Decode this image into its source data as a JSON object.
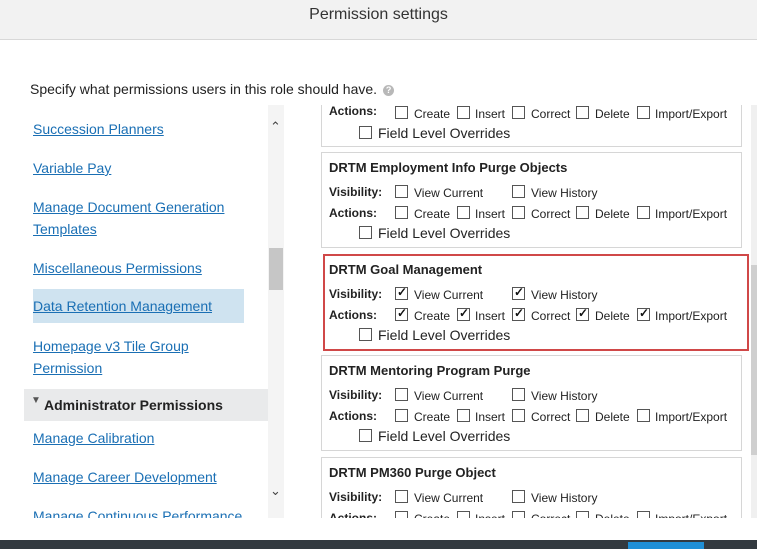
{
  "dialog": {
    "title": "Permission settings"
  },
  "description": {
    "text": "Specify what permissions users in this role should have.",
    "help_icon": "?"
  },
  "left_nav": {
    "items": [
      {
        "label": "Succession Planners"
      },
      {
        "label": "Variable Pay"
      },
      {
        "label": "Manage Document Generation Templates"
      },
      {
        "label": "Miscellaneous Permissions"
      },
      {
        "label": "Data Retention Management",
        "selected": true
      },
      {
        "label": "Homepage v3 Tile Group Permission"
      }
    ],
    "section": {
      "label": "Administrator Permissions",
      "icon": "triangle-down-icon"
    },
    "section_items": [
      {
        "label": "Manage Calibration"
      },
      {
        "label": "Manage Career Development"
      },
      {
        "label": "Manage Continuous Performance"
      }
    ],
    "scroll_up": "⌃",
    "scroll_down": "⌄"
  },
  "labels": {
    "visibility": "Visibility:",
    "actions": "Actions:",
    "view_current": "View Current",
    "view_history": "View History",
    "create": "Create",
    "insert": "Insert",
    "correct": "Correct",
    "delete": "Delete",
    "import_export": "Import/Export",
    "field_overrides": "Field Level Overrides"
  },
  "cards": [
    {
      "title": "",
      "visibility": null,
      "actions": {
        "create": false,
        "insert": false,
        "correct": false,
        "delete": false,
        "import_export": false
      },
      "field_overrides": false
    },
    {
      "title": "DRTM Employment Info Purge Objects",
      "visibility": {
        "view_current": false,
        "view_history": false
      },
      "actions": {
        "create": false,
        "insert": false,
        "correct": false,
        "delete": false,
        "import_export": false
      },
      "field_overrides": false
    },
    {
      "title": "DRTM Goal Management",
      "highlighted": true,
      "visibility": {
        "view_current": true,
        "view_history": true
      },
      "actions": {
        "create": true,
        "insert": true,
        "correct": true,
        "delete": true,
        "import_export": true
      },
      "field_overrides": false
    },
    {
      "title": "DRTM Mentoring Program Purge",
      "visibility": {
        "view_current": false,
        "view_history": false
      },
      "actions": {
        "create": false,
        "insert": false,
        "correct": false,
        "delete": false,
        "import_export": false
      },
      "field_overrides": false
    },
    {
      "title": "DRTM PM360 Purge Object",
      "visibility": {
        "view_current": false,
        "view_history": false
      },
      "actions": {
        "create": false,
        "insert": false,
        "correct": false,
        "delete": false,
        "import_export": false
      },
      "field_overrides": false
    }
  ],
  "colors": {
    "link": "#1a6fb4",
    "highlight_border": "#d04848",
    "selected_bg": "#cfe3f0",
    "footer": "#333a40",
    "footer_accent": "#1f8fd6"
  }
}
